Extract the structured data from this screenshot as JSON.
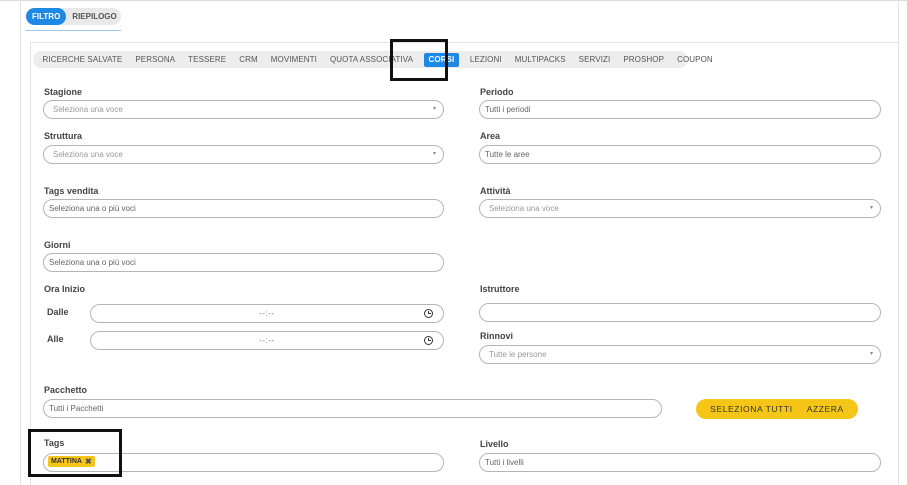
{
  "main_tabs": [
    {
      "label": "FILTRO",
      "active": true
    },
    {
      "label": "RIEPILOGO",
      "active": false
    }
  ],
  "sub_tabs": [
    {
      "label": "RICERCHE SALVATE"
    },
    {
      "label": "PERSONA"
    },
    {
      "label": "TESSERE"
    },
    {
      "label": "CRM"
    },
    {
      "label": "MOVIMENTI"
    },
    {
      "label": "QUOTA ASSOCIATIVA"
    },
    {
      "label": "CORSI",
      "active": true
    },
    {
      "label": "LEZIONI"
    },
    {
      "label": "MULTIPACKS"
    },
    {
      "label": "SERVIZI"
    },
    {
      "label": "PROSHOP"
    },
    {
      "label": "COUPON"
    }
  ],
  "form": {
    "stagione": {
      "label": "Stagione",
      "placeholder": "Seleziona una voce"
    },
    "periodo": {
      "label": "Periodo",
      "value": "Tutti i periodi"
    },
    "struttura": {
      "label": "Struttura",
      "placeholder": "Seleziona una voce"
    },
    "area": {
      "label": "Area",
      "value": "Tutte le aree"
    },
    "tags_vendita": {
      "label": "Tags vendita",
      "value": "Seleziona una o più voci"
    },
    "attivita": {
      "label": "Attività",
      "placeholder": "Seleziona una voce"
    },
    "giorni": {
      "label": "Giorni",
      "value": "Seleziona una o più voci"
    },
    "ora_inizio": {
      "label": "Ora Inizio",
      "dalle_label": "Dalle",
      "alle_label": "Alle",
      "dalle_value": "--:--",
      "alle_value": "--:--"
    },
    "istruttore": {
      "label": "Istruttore",
      "value": ""
    },
    "rinnovi": {
      "label": "Rinnovi",
      "placeholder": "Tutte le persone"
    },
    "pacchetto": {
      "label": "Pacchetto",
      "value": "Tutti i Pacchetti"
    },
    "tags": {
      "label": "Tags",
      "chip": "MATTINA"
    },
    "livello": {
      "label": "Livello",
      "value": "Tutti i livelli"
    }
  },
  "actions": {
    "select_all": "SELEZIONA TUTTI",
    "reset": "AZZERA"
  },
  "icons": {
    "caret": "▾",
    "chip_remove": "✖"
  },
  "colors": {
    "accent_blue": "#1e88e5",
    "accent_yellow": "#f5c518",
    "highlight_box": "#111111"
  }
}
